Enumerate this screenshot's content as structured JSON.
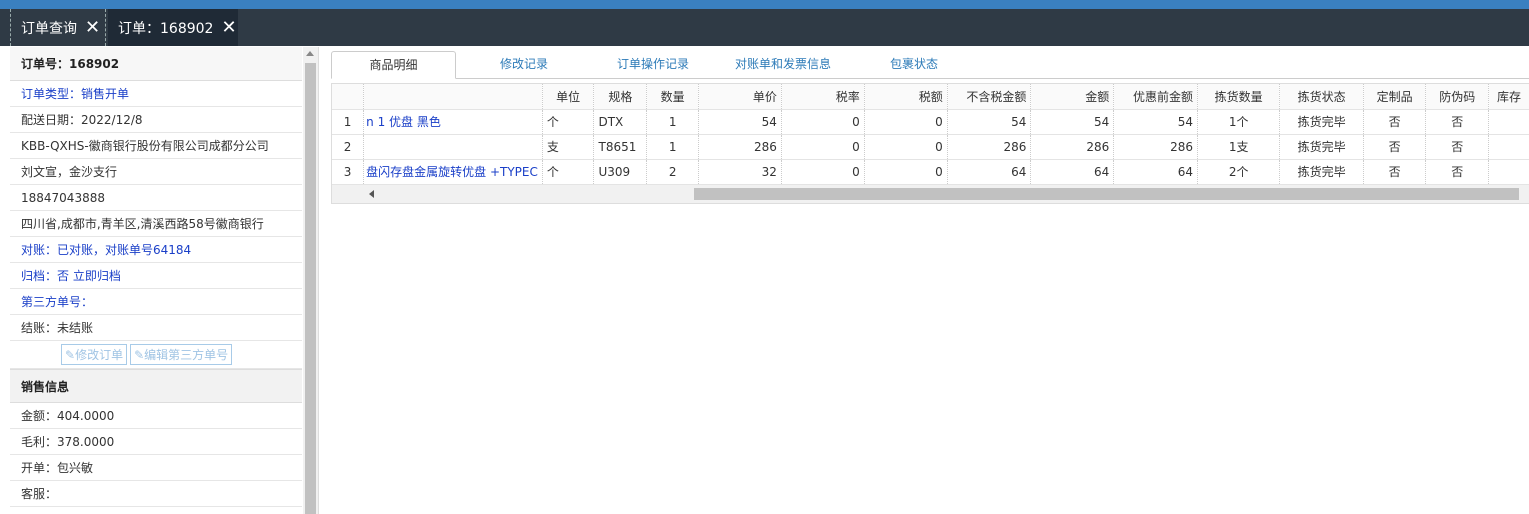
{
  "tabs": [
    {
      "label": "订单查询"
    },
    {
      "label": "订单：168902"
    }
  ],
  "left_panel": {
    "order_no": "订单号：168902",
    "order_type": "订单类型：销售开单",
    "delivery_date": "配送日期：2022/12/8",
    "customer": "KBB-QXHS-徽商银行股份有限公司成都分公司",
    "contact": "刘文宣，金沙支行",
    "phone": "18847043888",
    "address": "四川省,成都市,青羊区,清溪西路58号徽商银行",
    "reconcile": "对账：已对账，对账单号64184",
    "archive_label": "归档：",
    "archive_value": "否 立即归档",
    "third_party": "第三方单号：",
    "settle": "结账：未结账",
    "edit_order_btn": "修改订单",
    "edit_third_btn": "编辑第三方单号",
    "sales_section": "销售信息",
    "amount": "金额：404.0000",
    "profit": "毛利：378.0000",
    "opener": "开单：包兴敏",
    "service": "客服："
  },
  "subtabs": [
    {
      "label": "商品明细",
      "active": true
    },
    {
      "label": "修改记录",
      "active": false
    },
    {
      "label": "订单操作记录",
      "active": false
    },
    {
      "label": "对账单和发票信息",
      "active": false
    },
    {
      "label": "包裹状态",
      "active": false
    }
  ],
  "grid": {
    "headers": [
      "",
      "",
      "单位",
      "规格",
      "数量",
      "单价",
      "税率",
      "税额",
      "不含税金额",
      "金额",
      "优惠前金额",
      "拣货数量",
      "拣货状态",
      "定制品",
      "防伪码",
      "库存"
    ],
    "rows": [
      [
        "1",
        "n 1 优盘 黑色",
        "个",
        "DTX",
        "1",
        "54",
        "0",
        "0",
        "54",
        "54",
        "54",
        "1个",
        "拣货完毕",
        "否",
        "否",
        ""
      ],
      [
        "2",
        "",
        "支",
        "T8651",
        "1",
        "286",
        "0",
        "0",
        "286",
        "286",
        "286",
        "1支",
        "拣货完毕",
        "否",
        "否",
        ""
      ],
      [
        "3",
        "盘闪存盘金属旋转优盘 +TYPEC",
        "个",
        "U309",
        "2",
        "32",
        "0",
        "0",
        "64",
        "64",
        "64",
        "2个",
        "拣货完毕",
        "否",
        "否",
        ""
      ]
    ]
  }
}
